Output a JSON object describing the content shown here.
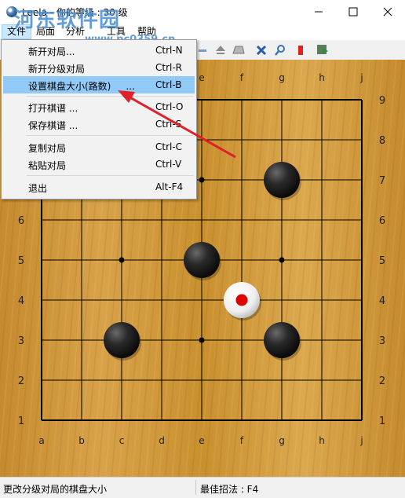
{
  "window": {
    "title": "Leela - 你的等级 : 30 级"
  },
  "menubar": {
    "items": [
      "文件",
      "局面",
      "分析",
      "工具",
      "帮助"
    ]
  },
  "toolbar": {
    "icons": [
      "minus-icon",
      "eject-icon",
      "eraser-icon",
      "cross-icon",
      "magnifier-icon",
      "bookmark-icon",
      "export-icon"
    ]
  },
  "file_menu": {
    "items": [
      {
        "label": "新开对局...",
        "shortcut": "Ctrl-N"
      },
      {
        "label": "新开分级对局",
        "shortcut": "Ctrl-R"
      },
      {
        "label": "设置棋盘大小(路数)     ...",
        "shortcut": "Ctrl-B",
        "highlighted": true
      },
      {
        "label": "打开棋谱 ...",
        "shortcut": "Ctrl-O"
      },
      {
        "label": "保存棋谱 ...",
        "shortcut": "Ctrl-S"
      },
      {
        "label": "复制对局",
        "shortcut": "Ctrl-C"
      },
      {
        "label": "粘贴对局",
        "shortcut": "Ctrl-V"
      },
      {
        "label": "退出",
        "shortcut": "Alt-F4"
      }
    ]
  },
  "board": {
    "size": 9,
    "columns": [
      "a",
      "b",
      "c",
      "d",
      "e",
      "f",
      "g",
      "h",
      "j"
    ],
    "rows": [
      "1",
      "2",
      "3",
      "4",
      "5",
      "6",
      "7",
      "8",
      "9"
    ],
    "stones": [
      {
        "color": "black",
        "col": "g",
        "row": 7
      },
      {
        "color": "black",
        "col": "e",
        "row": 5
      },
      {
        "color": "black",
        "col": "c",
        "row": 3
      },
      {
        "color": "black",
        "col": "g",
        "row": 3
      },
      {
        "color": "white",
        "col": "f",
        "row": 4,
        "last_move": true
      }
    ],
    "star_points": [
      {
        "col": "c",
        "row": 5
      },
      {
        "col": "g",
        "row": 5
      },
      {
        "col": "e",
        "row": 7
      },
      {
        "col": "e",
        "row": 3
      },
      {
        "col": "c",
        "row": 7
      },
      {
        "col": "g",
        "row": 7
      }
    ]
  },
  "statusbar": {
    "left": "更改分级对局的棋盘大小",
    "right": "最佳招法 : F4"
  },
  "watermark": {
    "cn": "河东软件园",
    "url": "www.pc0359.cn"
  },
  "colors": {
    "accent": "#91c9f7",
    "arrow": "#e0202a",
    "last_move_marker": "#e00000"
  }
}
